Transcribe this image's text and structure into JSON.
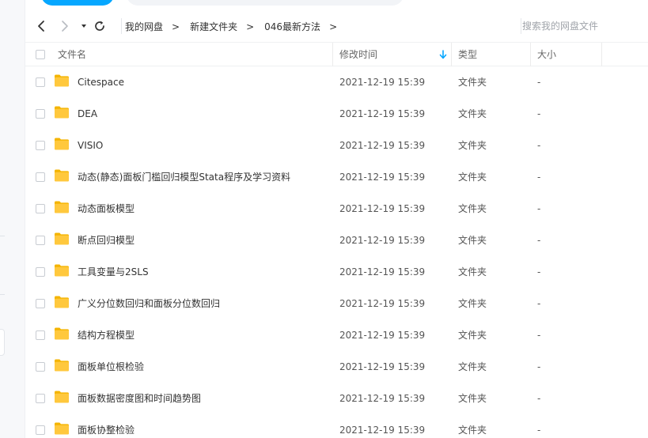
{
  "breadcrumb": {
    "items": [
      "我的网盘",
      "新建文件夹",
      "046最新方法"
    ],
    "separator": ">"
  },
  "search": {
    "placeholder": "搜索我的网盘文件"
  },
  "table": {
    "headers": {
      "name": "文件名",
      "modified": "修改时间",
      "type": "类型",
      "size": "大小"
    },
    "sort": {
      "column": "modified",
      "direction": "descending",
      "icon": "arrow-down-icon"
    },
    "rows": [
      {
        "name": "Citespace",
        "modified": "2021-12-19 15:39",
        "type": "文件夹",
        "size": "-"
      },
      {
        "name": "DEA",
        "modified": "2021-12-19 15:39",
        "type": "文件夹",
        "size": "-"
      },
      {
        "name": "VISIO",
        "modified": "2021-12-19 15:39",
        "type": "文件夹",
        "size": "-"
      },
      {
        "name": "动态(静态)面板门槛回归模型Stata程序及学习资料",
        "modified": "2021-12-19 15:39",
        "type": "文件夹",
        "size": "-"
      },
      {
        "name": "动态面板模型",
        "modified": "2021-12-19 15:39",
        "type": "文件夹",
        "size": "-"
      },
      {
        "name": "断点回归模型",
        "modified": "2021-12-19 15:39",
        "type": "文件夹",
        "size": "-"
      },
      {
        "name": "工具变量与2SLS",
        "modified": "2021-12-19 15:39",
        "type": "文件夹",
        "size": "-"
      },
      {
        "name": "广义分位数回归和面板分位数回归",
        "modified": "2021-12-19 15:39",
        "type": "文件夹",
        "size": "-"
      },
      {
        "name": "结构方程模型",
        "modified": "2021-12-19 15:39",
        "type": "文件夹",
        "size": "-"
      },
      {
        "name": "面板单位根检验",
        "modified": "2021-12-19 15:39",
        "type": "文件夹",
        "size": "-"
      },
      {
        "name": "面板数据密度图和时间趋势图",
        "modified": "2021-12-19 15:39",
        "type": "文件夹",
        "size": "-"
      },
      {
        "name": "面板协整检验",
        "modified": "2021-12-19 15:39",
        "type": "文件夹",
        "size": "-"
      }
    ]
  },
  "colors": {
    "accent": "#06a7ff",
    "folder": "#ffc83d",
    "folder_tab": "#f4b400"
  },
  "icons": {
    "back": "chevron-left-icon",
    "forward": "chevron-right-icon",
    "history": "caret-down-icon",
    "refresh": "refresh-icon",
    "folder": "folder-icon"
  }
}
